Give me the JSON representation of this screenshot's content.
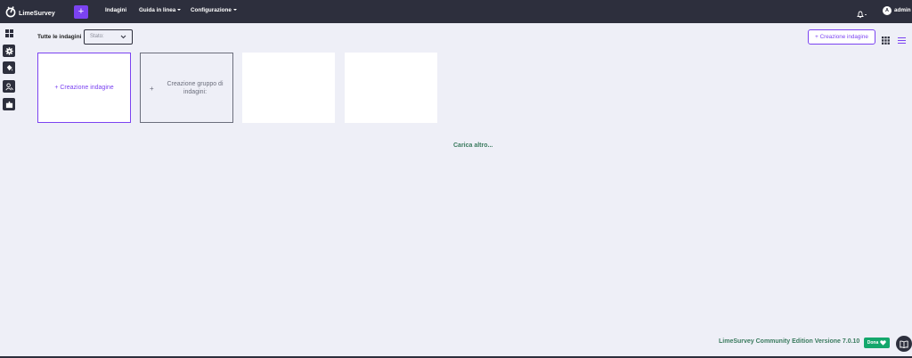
{
  "app": {
    "name": "LimeSurvey"
  },
  "topbar": {
    "plus_label": "+",
    "nav": [
      {
        "label": "Indagini",
        "has_caret": false
      },
      {
        "label": "Guida in linea",
        "has_caret": true
      },
      {
        "label": "Configurazione",
        "has_caret": true
      }
    ],
    "user": {
      "initial": "A",
      "name": "admin"
    }
  },
  "sidebar": {
    "items": [
      {
        "icon": "grid-icon"
      },
      {
        "icon": "gear-icon"
      },
      {
        "icon": "paint-bucket-icon"
      },
      {
        "icon": "users-icon"
      },
      {
        "icon": "puzzle-icon"
      }
    ]
  },
  "filter": {
    "label": "Tutte le indagini",
    "status_placeholder": "Stato:"
  },
  "actions": {
    "create_survey": "+ Creazione indagine"
  },
  "cards": {
    "create_survey": "+ Creazione indagine",
    "create_group_plus": "+",
    "create_group": "Creazione gruppo di indagini:"
  },
  "load_more": "Carica altro...",
  "footer": {
    "edition": "LimeSurvey Community Edition Versione 7.0.10",
    "donate": "Dona"
  },
  "colors": {
    "topbar": "#2d2f3d",
    "accent": "#7b43f1",
    "link_green": "#3a7a5e",
    "donate_green": "#14a76c",
    "background": "#eeeff7"
  }
}
